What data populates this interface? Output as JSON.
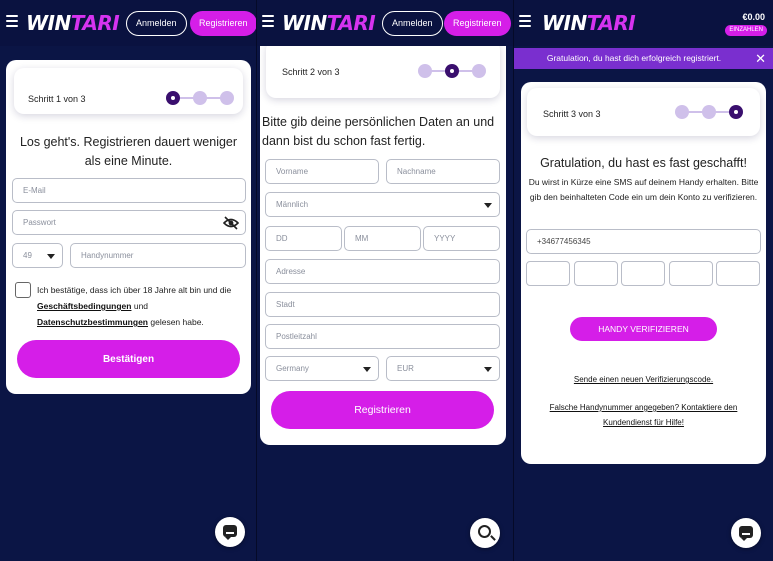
{
  "brand": {
    "logo_left": "WIN",
    "logo_right": "TARI",
    "accent": "#d51ee8",
    "step_active": "#3a0f6e",
    "step_inactive": "#cfc0ea",
    "bg": "#0a1240"
  },
  "header": {
    "login_label": "Anmelden",
    "register_label": "Registrieren"
  },
  "step1": {
    "step_label": "Schritt 1 von 3",
    "heading": "Los geht's. Registrieren dauert weniger als eine Minute.",
    "email_placeholder": "E-Mail",
    "password_placeholder": "Passwort",
    "country_code": "49",
    "phone_placeholder": "Handynummer",
    "terms_prefix": "Ich bestätige, dass ich über 18 Jahre alt bin und die",
    "terms_link1": "Geschäftsbedingungen",
    "terms_and": "und",
    "terms_link2": "Datenschutzbestimmungen",
    "terms_suffix": "gelesen habe.",
    "confirm_label": "Bestätigen"
  },
  "step2": {
    "step_label": "Schritt 2 von 3",
    "heading": "Bitte gib deine persönlichen Daten an und dann bist du schon fast fertig.",
    "firstname_placeholder": "Vorname",
    "lastname_placeholder": "Nachname",
    "gender_value": "Männlich",
    "day_placeholder": "DD",
    "month_placeholder": "MM",
    "year_placeholder": "YYYY",
    "address_placeholder": "Adresse",
    "city_placeholder": "Stadt",
    "zip_placeholder": "Postleitzahl",
    "country_value": "Germany",
    "currency_value": "EUR",
    "register_label": "Registrieren"
  },
  "step3": {
    "balance": "€0.00",
    "deposit_label": "EINZAHLEN",
    "banner": "Gratulation, du hast dich erfolgreich registriert.",
    "step_label": "Schritt 3 von 3",
    "heading": "Gratulation, du hast es fast geschafft!",
    "subtext": "Du wirst in Kürze eine SMS auf deinem Handy erhalten. Bitte gib den beinhalteten Code ein um dein Konto zu verifizieren.",
    "phone_value": "+34677456345",
    "verify_label": "HANDY VERIFIZIEREN",
    "resend_link": "Sende einen neuen Verifizierungscode.",
    "wrong_number_link": "Falsche Handynummer angegeben? Kontaktiere den Kundendienst für Hilfe!"
  }
}
